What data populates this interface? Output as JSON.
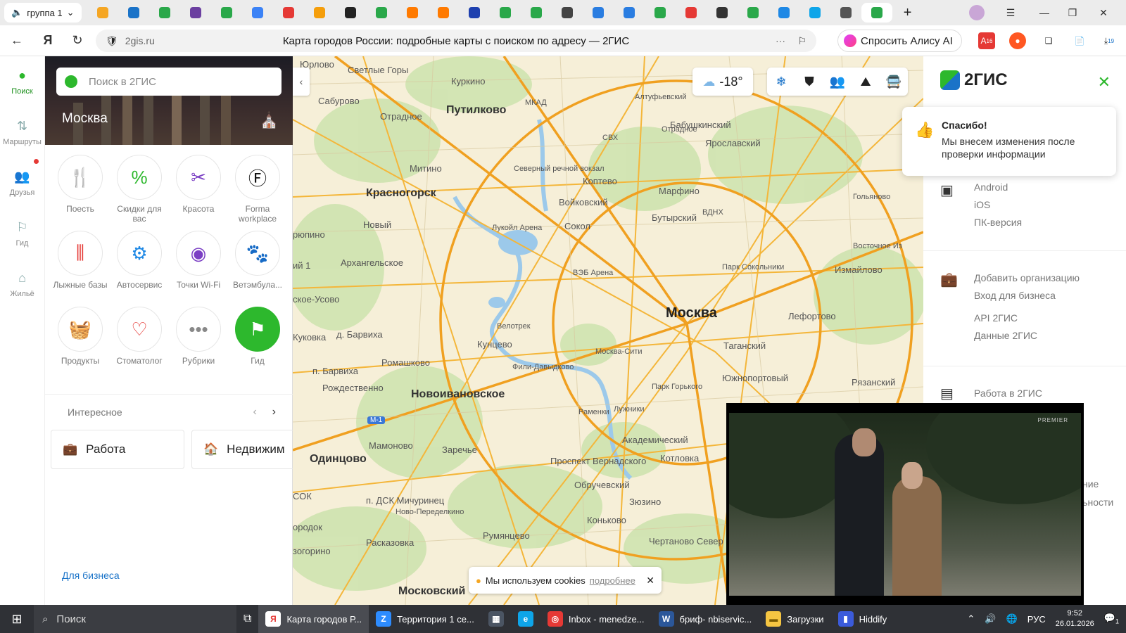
{
  "browser": {
    "tab_group_label": "группа 1",
    "tab_colors": [
      "#f5a623",
      "#1a73c8",
      "#2aa84a",
      "#6b3fa0",
      "#2aa84a",
      "#3b82f6",
      "#e53935",
      "#f59e0b",
      "#222222",
      "#2aa84a",
      "#ff7a00",
      "#ff7a00",
      "#1e40af",
      "#2aa84a",
      "#2aa84a",
      "#444444",
      "#2a7de1",
      "#2a7de1",
      "#2aa84a",
      "#e53935",
      "#333333",
      "#2aa84a",
      "#1e88e5",
      "#0ea5e9",
      "#555555",
      "#2aa84a"
    ],
    "url": "2gis.ru",
    "title": "Карта городов России: подробные карты с поиском по адресу — 2ГИС",
    "alice_label": "Спросить Алису AI",
    "badge_1": "16",
    "badge_2": "19"
  },
  "rail": [
    {
      "label": "Поиск",
      "icon": "map-pin-icon"
    },
    {
      "label": "Маршруты",
      "icon": "route-icon"
    },
    {
      "label": "Друзья",
      "icon": "friends-icon"
    },
    {
      "label": "Гид",
      "icon": "flag-icon"
    },
    {
      "label": "Жильё",
      "icon": "home-icon"
    }
  ],
  "panel": {
    "search_placeholder": "Поиск в 2ГИС",
    "city": "Москва",
    "rubrics": [
      {
        "label": "Поесть",
        "icon": "fork-knife-icon",
        "glyph": "🍴",
        "color": "#ff8a00"
      },
      {
        "label": "Скидки для вас",
        "icon": "percent-icon",
        "glyph": "%",
        "color": "#2db82d"
      },
      {
        "label": "Красота",
        "icon": "scissors-icon",
        "glyph": "✂",
        "color": "#7b3fc4"
      },
      {
        "label": "Forma workplace",
        "icon": "forma-icon",
        "glyph": "Ⓕ",
        "color": "#111111"
      },
      {
        "label": "Лыжные базы",
        "icon": "ski-icon",
        "glyph": "⫼",
        "color": "#e53935"
      },
      {
        "label": "Автосервис",
        "icon": "engine-icon",
        "glyph": "⚙",
        "color": "#1e88e5"
      },
      {
        "label": "Точки Wi-Fi",
        "icon": "wifi-icon",
        "glyph": "◉",
        "color": "#7b3fc4"
      },
      {
        "label": "Ветэмбула...",
        "icon": "vet-ambulance-icon",
        "glyph": "🐾",
        "color": "#444444"
      },
      {
        "label": "Продукты",
        "icon": "basket-icon",
        "glyph": "🧺",
        "color": "#2db82d"
      },
      {
        "label": "Стоматолог",
        "icon": "tooth-icon",
        "glyph": "♡",
        "color": "#e53935"
      },
      {
        "label": "Рубрики",
        "icon": "more-icon",
        "glyph": "•••",
        "color": "#888888"
      },
      {
        "label": "Гид",
        "icon": "flag-icon",
        "glyph": "⚑",
        "color": "#ffffff",
        "green": true
      }
    ],
    "interesting_label": "Интересное",
    "cards": [
      {
        "label": "Работа",
        "icon": "briefcase-icon"
      },
      {
        "label": "Недвижим",
        "icon": "house-icon"
      }
    ],
    "business_link": "Для бизнеса"
  },
  "map": {
    "weather": "-18°",
    "places": [
      {
        "t": "Юрлово"
      },
      {
        "t": "Светлые Горы"
      },
      {
        "t": "Куркино"
      },
      {
        "t": "Сабурово"
      },
      {
        "t": "Путилково"
      },
      {
        "t": "Отрадное"
      },
      {
        "t": "Алтуфьевский"
      },
      {
        "t": "Бабушкинский"
      },
      {
        "t": "Отрадное"
      },
      {
        "t": "Ярославский"
      },
      {
        "t": "Митино"
      },
      {
        "t": "Северный речной вокзал"
      },
      {
        "t": "Коптево"
      },
      {
        "t": "Марфино"
      },
      {
        "t": "Красногорск"
      },
      {
        "t": "Войковский"
      },
      {
        "t": "ВДНХ"
      },
      {
        "t": "Гольяново"
      },
      {
        "t": "Новый"
      },
      {
        "t": "Лукойл Арена"
      },
      {
        "t": "Сокол"
      },
      {
        "t": "Бутырский"
      },
      {
        "t": "рюпино"
      },
      {
        "t": "Восточное Из"
      },
      {
        "t": "ВЭБ Арена"
      },
      {
        "t": "Парк Сокольники"
      },
      {
        "t": "Измайлово"
      },
      {
        "t": "ий 1"
      },
      {
        "t": "Архангельское"
      },
      {
        "t": "Москва"
      },
      {
        "t": "Лефортово"
      },
      {
        "t": "ское-Усово"
      },
      {
        "t": "Велотрек"
      },
      {
        "t": "д. Барвиха"
      },
      {
        "t": "Кунцево"
      },
      {
        "t": "Москва-Сити"
      },
      {
        "t": "Таганский"
      },
      {
        "t": "Куковка"
      },
      {
        "t": "Ромашково"
      },
      {
        "t": "п. Барвиха"
      },
      {
        "t": "Фили-Давыдково"
      },
      {
        "t": "Южнопортовый"
      },
      {
        "t": "Рязанский"
      },
      {
        "t": "Рождественно"
      },
      {
        "t": "Новоивановское"
      },
      {
        "t": "Парк Горького"
      },
      {
        "t": "Раменки"
      },
      {
        "t": "Лужники"
      },
      {
        "t": "М-1"
      },
      {
        "t": "Мамоново"
      },
      {
        "t": "Заречье"
      },
      {
        "t": "Академический"
      },
      {
        "t": "Одинцово"
      },
      {
        "t": "Проспект Вернадского"
      },
      {
        "t": "Котловка"
      },
      {
        "t": "Обручевский"
      },
      {
        "t": "СОК"
      },
      {
        "t": "п. ДСК Мичуринец"
      },
      {
        "t": "Зюзино"
      },
      {
        "t": "Ново-Переделкино"
      },
      {
        "t": "Коньково"
      },
      {
        "t": "ородок"
      },
      {
        "t": "Румянцево"
      },
      {
        "t": "Расказовка"
      },
      {
        "t": "Чертаново Север"
      },
      {
        "t": "зогорино"
      },
      {
        "t": "Московский"
      },
      {
        "t": "МКАД"
      },
      {
        "t": "СВХ"
      }
    ],
    "cookie_text": "Мы используем cookies",
    "cookie_more": "подробнее"
  },
  "right": {
    "logo": "2ГИС",
    "toast_title": "Спасибо!",
    "toast_text": "Мы внесем изменения после проверки информации",
    "apps": [
      "Android",
      "iOS",
      "ПК-версия"
    ],
    "business": [
      "Добавить организацию",
      "Вход для бизнеса",
      "API 2ГИС",
      "Данные 2ГИС"
    ],
    "jobs": "Работа в 2ГИС",
    "cut_1": "ние",
    "cut_2": "льности"
  },
  "video": {
    "brand": "PREMIER"
  },
  "taskbar": {
    "search": "Поиск",
    "apps": [
      {
        "label": "Карта городов Р...",
        "icon": "yandex-browser-icon",
        "bg": "#ffffff",
        "fg": "#e53935",
        "glyph": "Я",
        "active": true
      },
      {
        "label": "Территория 1 се...",
        "icon": "zoom-icon",
        "bg": "#2d8cff",
        "fg": "#ffffff",
        "glyph": "Z"
      },
      {
        "label": "",
        "icon": "calculator-icon",
        "bg": "#4b5563",
        "fg": "#ffffff",
        "glyph": "▦"
      },
      {
        "label": "",
        "icon": "edge-icon",
        "bg": "#0ea5e9",
        "fg": "#ffffff",
        "glyph": "e"
      },
      {
        "label": "Inbox - menedze...",
        "icon": "chrome-icon",
        "bg": "#e53935",
        "fg": "#ffffff",
        "glyph": "◎"
      },
      {
        "label": "бриф- nbiservic...",
        "icon": "word-icon",
        "bg": "#2b579a",
        "fg": "#ffffff",
        "glyph": "W"
      },
      {
        "label": "Загрузки",
        "icon": "folder-icon",
        "bg": "#f5c542",
        "fg": "#7a5a00",
        "glyph": "▬"
      },
      {
        "label": "Hiddify",
        "icon": "hiddify-icon",
        "bg": "#3b5bdb",
        "fg": "#ffffff",
        "glyph": "▮"
      }
    ],
    "lang": "РУС",
    "time": "9:52",
    "date": "26.01.2026",
    "notif": "1"
  }
}
